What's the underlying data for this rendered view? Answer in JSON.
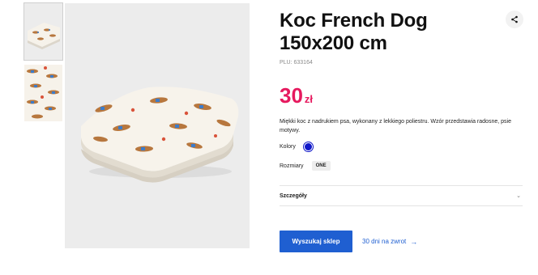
{
  "gallery": {
    "thumbnails": [
      {
        "alt": "blanket-folded-icon"
      },
      {
        "alt": "blanket-pattern-icon"
      }
    ],
    "main_alt": "folded-blanket-image"
  },
  "product": {
    "title": "Koc French Dog 150x200 cm",
    "plu": "PLU: 633164",
    "price_amount": "30",
    "price_currency": "zł",
    "price_color": "#e6195e",
    "description": "Miękki koc z nadrukiem psa, wykonany z lekkiego poliestru. Wzór przedstawia radosne, psie motywy.",
    "colors_label": "Kolory",
    "selected_color": "#1018c9",
    "sizes_label": "Rozmiary",
    "sizes": [
      "ONE"
    ],
    "details_label": "Szczegóły"
  },
  "actions": {
    "primary_label": "Wyszukaj sklep",
    "primary_color": "#1f5fd1",
    "return_link": "30 dni na zwrot"
  },
  "icons": {
    "share": "share-icon",
    "chevron": "chevron-down-icon",
    "arrow": "arrow-right-icon"
  }
}
